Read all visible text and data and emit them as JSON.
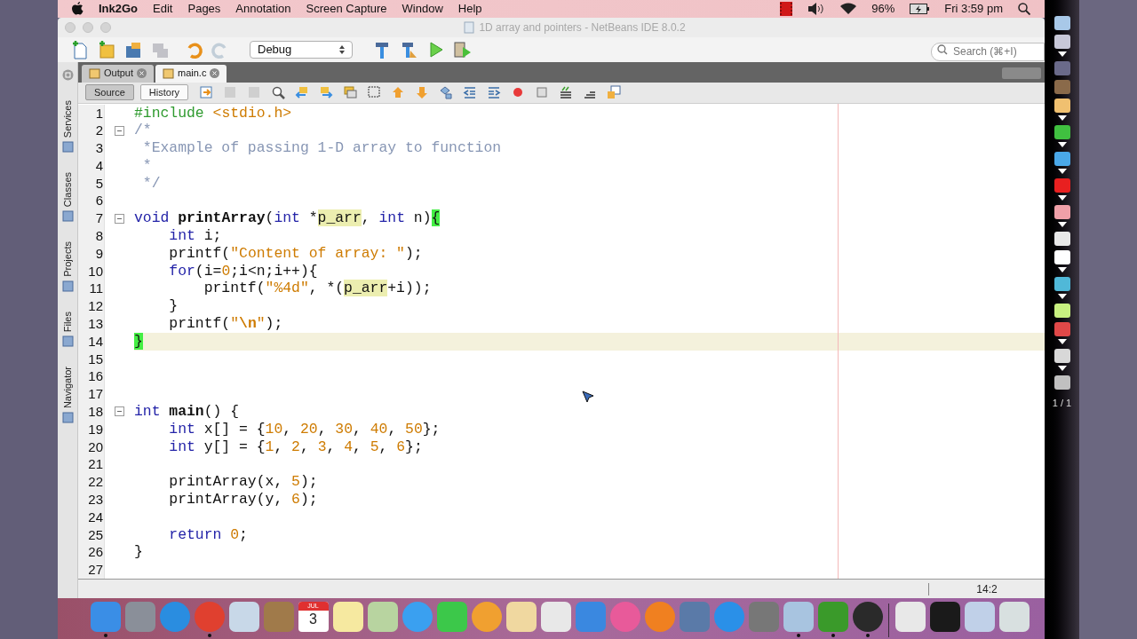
{
  "menubar": {
    "app": "Ink2Go",
    "items": [
      "Edit",
      "Pages",
      "Annotation",
      "Screen Capture",
      "Window",
      "Help"
    ],
    "battery": "96%",
    "clock": "Fri 3:59 pm"
  },
  "window": {
    "title": "1D array and pointers - NetBeans IDE 8.0.2"
  },
  "toolbar": {
    "buttons": [
      {
        "kind": "new-file",
        "disabled": false
      },
      {
        "kind": "new-project",
        "disabled": false
      },
      {
        "kind": "open-project",
        "disabled": false
      },
      {
        "kind": "save",
        "disabled": true
      },
      {
        "kind": "undo",
        "disabled": false
      },
      {
        "kind": "redo",
        "disabled": true
      }
    ],
    "config": "Debug",
    "actions": [
      {
        "kind": "build",
        "disabled": false
      },
      {
        "kind": "clean",
        "disabled": false
      },
      {
        "kind": "run",
        "disabled": false
      },
      {
        "kind": "debug",
        "disabled": false
      }
    ],
    "search": {
      "placeholder": "Search (⌘+I)"
    }
  },
  "side_tabs": [
    "Services",
    "Classes",
    "Projects",
    "Files",
    "Navigator"
  ],
  "tabs": [
    {
      "label": "Output",
      "selected": false
    },
    {
      "label": "main.c",
      "selected": true
    }
  ],
  "view_tabs": [
    {
      "label": "Source",
      "selected": true
    },
    {
      "label": "History",
      "selected": false
    }
  ],
  "editor_tools": [
    {
      "kind": "jump"
    },
    {
      "kind": "back"
    },
    {
      "kind": "forward"
    },
    {
      "kind": "find"
    },
    {
      "kind": "prev"
    },
    {
      "kind": "next"
    },
    {
      "kind": "highlight"
    },
    {
      "kind": "select"
    },
    {
      "kind": "up"
    },
    {
      "kind": "down"
    },
    {
      "kind": "toggle"
    },
    {
      "kind": "shift-left"
    },
    {
      "kind": "shift-right"
    },
    {
      "kind": "record"
    },
    {
      "kind": "stop"
    },
    {
      "kind": "comment"
    },
    {
      "kind": "uncomment"
    },
    {
      "kind": "diff"
    }
  ],
  "code": [
    {
      "number": "1",
      "tokens": [
        {
          "kind": "pre",
          "t": "#include"
        },
        {
          "kind": "str",
          "t": " <stdio.h>"
        }
      ]
    },
    {
      "number": "2",
      "fold": true,
      "tokens": [
        {
          "kind": "cmt",
          "t": "/*"
        }
      ]
    },
    {
      "number": "3",
      "tokens": [
        {
          "kind": "cmt",
          "t": " *Example of passing 1-D array to function"
        }
      ]
    },
    {
      "number": "4",
      "tokens": [
        {
          "kind": "cmt",
          "t": " *"
        }
      ]
    },
    {
      "number": "5",
      "tokens": [
        {
          "kind": "cmt",
          "t": " */"
        }
      ]
    },
    {
      "number": "6"
    },
    {
      "number": "7",
      "fold": true,
      "tokens": [
        {
          "kind": "kw",
          "t": "void"
        },
        {
          "kind": "fn",
          "t": " printArray"
        },
        {
          "kind": "p",
          "t": "("
        },
        {
          "kind": "kw",
          "t": "int"
        },
        {
          "kind": "p",
          "t": " *"
        },
        {
          "kind": "hl",
          "t": "p_arr"
        },
        {
          "kind": "p",
          "t": ", "
        },
        {
          "kind": "kw",
          "t": "int"
        },
        {
          "kind": "p",
          "t": " n)"
        },
        {
          "kind": "brace",
          "t": "{"
        }
      ]
    },
    {
      "number": "8",
      "tokens": [
        {
          "kind": "kw",
          "t": "    int"
        },
        {
          "kind": "p",
          "t": " i;"
        }
      ]
    },
    {
      "number": "9",
      "tokens": [
        {
          "kind": "p",
          "t": "    printf("
        },
        {
          "kind": "str",
          "t": "\"Content of array: \""
        },
        {
          "kind": "p",
          "t": ");"
        }
      ]
    },
    {
      "number": "10",
      "tokens": [
        {
          "kind": "kw",
          "t": "    for"
        },
        {
          "kind": "p",
          "t": "(i="
        },
        {
          "kind": "num",
          "t": "0"
        },
        {
          "kind": "p",
          "t": ";i<n;i++){"
        }
      ]
    },
    {
      "number": "11",
      "tokens": [
        {
          "kind": "p",
          "t": "        printf("
        },
        {
          "kind": "str",
          "t": "\"%4d\""
        },
        {
          "kind": "p",
          "t": ", *("
        },
        {
          "kind": "hl",
          "t": "p_arr"
        },
        {
          "kind": "p",
          "t": "+i));"
        }
      ]
    },
    {
      "number": "12",
      "tokens": [
        {
          "kind": "p",
          "t": "    }"
        }
      ]
    },
    {
      "number": "13",
      "tokens": [
        {
          "kind": "p",
          "t": "    printf("
        },
        {
          "kind": "str",
          "t": "\""
        },
        {
          "kind": "esc",
          "t": "\\n"
        },
        {
          "kind": "str",
          "t": "\""
        },
        {
          "kind": "p",
          "t": ");"
        }
      ]
    },
    {
      "number": "14",
      "current": true,
      "tokens": [
        {
          "kind": "brace",
          "t": "}"
        }
      ]
    },
    {
      "number": "15"
    },
    {
      "number": "16"
    },
    {
      "number": "17"
    },
    {
      "number": "18",
      "fold": true,
      "tokens": [
        {
          "kind": "kw",
          "t": "int"
        },
        {
          "kind": "fn",
          "t": " main"
        },
        {
          "kind": "p",
          "t": "() {"
        }
      ]
    },
    {
      "number": "19",
      "tokens": [
        {
          "kind": "kw",
          "t": "    int"
        },
        {
          "kind": "p",
          "t": " x[] = {"
        },
        {
          "kind": "num",
          "t": "10"
        },
        {
          "kind": "p",
          "t": ", "
        },
        {
          "kind": "num",
          "t": "20"
        },
        {
          "kind": "p",
          "t": ", "
        },
        {
          "kind": "num",
          "t": "30"
        },
        {
          "kind": "p",
          "t": ", "
        },
        {
          "kind": "num",
          "t": "40"
        },
        {
          "kind": "p",
          "t": ", "
        },
        {
          "kind": "num",
          "t": "50"
        },
        {
          "kind": "p",
          "t": "};"
        }
      ]
    },
    {
      "number": "20",
      "tokens": [
        {
          "kind": "kw",
          "t": "    int"
        },
        {
          "kind": "p",
          "t": " y[] = {"
        },
        {
          "kind": "num",
          "t": "1"
        },
        {
          "kind": "p",
          "t": ", "
        },
        {
          "kind": "num",
          "t": "2"
        },
        {
          "kind": "p",
          "t": ", "
        },
        {
          "kind": "num",
          "t": "3"
        },
        {
          "kind": "p",
          "t": ", "
        },
        {
          "kind": "num",
          "t": "4"
        },
        {
          "kind": "p",
          "t": ", "
        },
        {
          "kind": "num",
          "t": "5"
        },
        {
          "kind": "p",
          "t": ", "
        },
        {
          "kind": "num",
          "t": "6"
        },
        {
          "kind": "p",
          "t": "};"
        }
      ]
    },
    {
      "number": "21"
    },
    {
      "number": "22",
      "tokens": [
        {
          "kind": "p",
          "t": "    printArray(x, "
        },
        {
          "kind": "num",
          "t": "5"
        },
        {
          "kind": "p",
          "t": ");"
        }
      ]
    },
    {
      "number": "23",
      "tokens": [
        {
          "kind": "p",
          "t": "    printArray(y, "
        },
        {
          "kind": "num",
          "t": "6"
        },
        {
          "kind": "p",
          "t": ");"
        }
      ]
    },
    {
      "number": "24"
    },
    {
      "number": "25",
      "tokens": [
        {
          "kind": "kw",
          "t": "    return"
        },
        {
          "kind": "num",
          "t": " 0"
        },
        {
          "kind": "p",
          "t": ";"
        }
      ]
    },
    {
      "number": "26",
      "tokens": [
        {
          "kind": "p",
          "t": "}"
        }
      ]
    },
    {
      "number": "27"
    }
  ],
  "status_bar": {
    "position": "14:2"
  },
  "dock": [
    {
      "kind": "app",
      "color": "#3a8ee6",
      "running": true
    },
    {
      "kind": "app",
      "color": "#8a8f99",
      "running": false
    },
    {
      "kind": "round",
      "color": "#2a8de0",
      "running": false
    },
    {
      "kind": "round",
      "color": "#e0402f",
      "running": true
    },
    {
      "kind": "app",
      "color": "#c8d8e8",
      "running": false
    },
    {
      "kind": "app",
      "color": "#a07a4a",
      "running": false
    },
    {
      "kind": "calendar",
      "month": "JUL",
      "day": "3",
      "running": false
    },
    {
      "kind": "app",
      "color": "#f6e9a0",
      "running": false
    },
    {
      "kind": "app",
      "color": "#b8d4a0",
      "running": false
    },
    {
      "kind": "round",
      "color": "#3aa0f0",
      "running": false
    },
    {
      "kind": "app",
      "color": "#3cc84a",
      "running": false
    },
    {
      "kind": "round",
      "color": "#f0a030",
      "running": false
    },
    {
      "kind": "app",
      "color": "#f0d8a0",
      "running": false
    },
    {
      "kind": "app",
      "color": "#e8e8e8",
      "running": false
    },
    {
      "kind": "app",
      "color": "#3a88e0",
      "running": false
    },
    {
      "kind": "round",
      "color": "#e85a9a",
      "running": false
    },
    {
      "kind": "round",
      "color": "#f08020",
      "running": false
    },
    {
      "kind": "app",
      "color": "#5a7aa8",
      "running": false
    },
    {
      "kind": "round",
      "color": "#2a90e8",
      "running": false
    },
    {
      "kind": "app",
      "color": "#777777",
      "running": false
    },
    {
      "kind": "app",
      "color": "#a8c4e0",
      "running": true
    },
    {
      "kind": "app",
      "color": "#3a9a2a",
      "running": true
    },
    {
      "kind": "round",
      "color": "#2a2a2a",
      "running": true
    },
    {
      "kind": "separator"
    },
    {
      "kind": "app",
      "color": "#e8e8e8",
      "running": false
    },
    {
      "kind": "app",
      "color": "#1a1a1a",
      "running": false
    },
    {
      "kind": "app",
      "color": "#c0d0e8",
      "running": false
    },
    {
      "kind": "app",
      "color": "#d8e0e0",
      "running": false
    }
  ],
  "ink_tools": [
    {
      "color": "#a8c8e8",
      "menu": false
    },
    {
      "color": "#c8c8d8",
      "menu": true
    },
    {
      "color": "#6a6a8a",
      "menu": false
    },
    {
      "color": "#8a6a4a",
      "menu": false
    },
    {
      "color": "#f0c070",
      "menu": true
    },
    {
      "color": "#40c040",
      "menu": true
    },
    {
      "color": "#4aa8e8",
      "menu": true
    },
    {
      "color": "#e82020",
      "menu": true
    },
    {
      "color": "#f0a0a8",
      "menu": true
    },
    {
      "color": "#e8e8e8",
      "menu": false
    },
    {
      "color": "#ffffff",
      "menu": true
    },
    {
      "color": "#50b8d8",
      "menu": true
    },
    {
      "color": "#c8f080",
      "menu": false
    },
    {
      "color": "#e04848",
      "menu": true
    },
    {
      "color": "#d8d8d8",
      "menu": true
    },
    {
      "color": "#c0c0c0",
      "menu": false
    }
  ],
  "ink_page": "1 / 1"
}
